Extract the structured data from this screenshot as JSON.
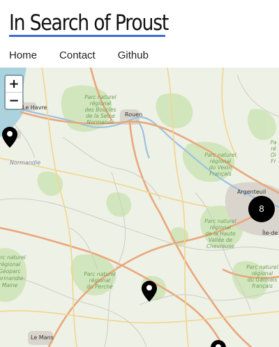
{
  "header": {
    "title": "In Search of Proust",
    "nav": [
      {
        "label": "Home"
      },
      {
        "label": "Contact"
      },
      {
        "label": "Github"
      }
    ]
  },
  "map": {
    "zoom_in": "+",
    "zoom_out": "−",
    "cluster_count": "8",
    "labels": {
      "le_havre": "Le Havre",
      "rouen": "Rouen",
      "normandie": "Normandie",
      "argenteuil": "Argenteuil",
      "le_mans": "Le Mans",
      "ile_de": "Île-de",
      "pnr_seine": [
        "Parc naturel",
        "régional",
        "des Boucles",
        "de la Seine",
        "Normande"
      ],
      "pnr_vexin": [
        "Parc naturel",
        "régional",
        "du Vexin",
        "Français"
      ],
      "pnr_chevreuse": [
        "Parc naturel",
        "régional",
        "de la Haute",
        "Vallée de",
        "Chevreuse"
      ],
      "pnr_perche": [
        "Parc naturel",
        "régional",
        "du Perche"
      ],
      "pnr_gatinais": [
        "Parc naturel",
        "régional",
        "du Gâtinais",
        "français"
      ],
      "pnr_normandie_maine": [
        "Parc naturel",
        "régional",
        "Géoparc",
        "Normandie-",
        "Maine"
      ],
      "pnr_oise": [
        "Pa",
        "ré",
        "Oi",
        "Fr"
      ]
    },
    "colors": {
      "land": "#eef1e6",
      "forest": "#cfe3b8",
      "park_text": "#7ca567",
      "water": "#9fc3e0",
      "major_road": "#e8a87c",
      "minor_road": "#ffffff",
      "urban": "#dcd8d2",
      "marker": "#000000"
    }
  }
}
